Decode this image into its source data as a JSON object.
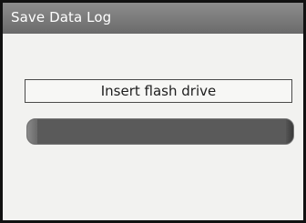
{
  "window": {
    "title": "Save Data Log"
  },
  "dialog": {
    "message": "Insert flash drive"
  },
  "progress": {
    "fraction": 1.0
  },
  "colors": {
    "title_bar": "#7a7a7a",
    "background": "#f2f2f0",
    "progress_bar": "#4a4a4a"
  }
}
